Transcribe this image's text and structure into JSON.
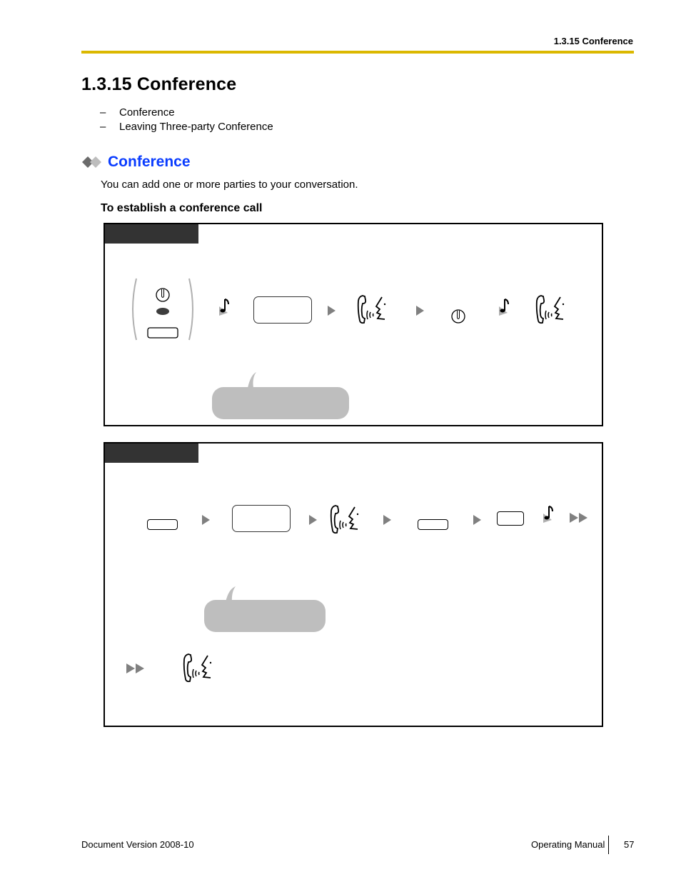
{
  "header": {
    "running_title": "1.3.15 Conference",
    "rule_color": "#dbb800"
  },
  "page": {
    "title": "1.3.15  Conference",
    "toc": [
      "Conference",
      "Leaving Three-party Conference"
    ]
  },
  "section": {
    "icon": "double-diamond-icon",
    "title": "Conference",
    "title_color": "#0a3cff",
    "description": "You can add one or more parties to your conversation.",
    "subheading": "To establish a conference call"
  },
  "procedure_boxes": [
    {
      "tab_label": "",
      "steps": [
        "off-hook-or-speaker-key-group-icon",
        "confirmation-tone-icon",
        "dial-display-field",
        "next-arrow-icon",
        "talk-icon",
        "next-arrow-icon",
        "on-hook-icon",
        "confirmation-tone-icon",
        "talk-icon"
      ],
      "note_bubble": ""
    },
    {
      "tab_label": "",
      "steps": [
        "key-button",
        "next-arrow-icon",
        "dial-display-field",
        "next-arrow-icon",
        "talk-icon",
        "next-arrow-icon",
        "key-button",
        "next-arrow-icon",
        "key-button",
        "confirmation-tone-icon",
        "continue-icon",
        "continue-icon",
        "talk-icon"
      ],
      "note_bubble": ""
    }
  ],
  "footer": {
    "document_version": "Document Version  2008-10",
    "manual_name": "Operating Manual",
    "page_number": "57"
  }
}
